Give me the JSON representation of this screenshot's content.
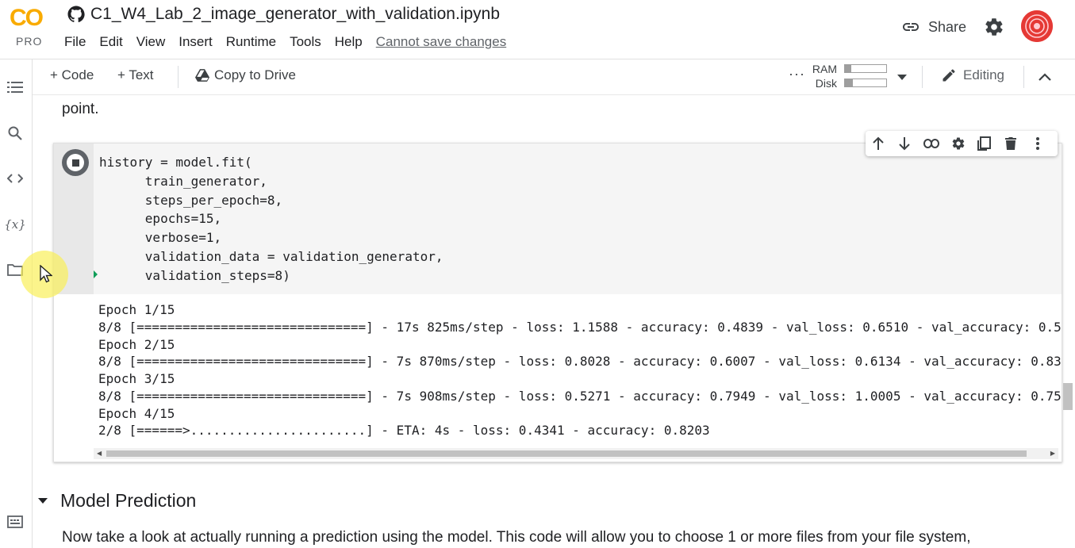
{
  "app": {
    "logo_text": "CO",
    "logo_tier": "PRO",
    "notebook_title": "C1_W4_Lab_2_image_generator_with_validation.ipynb",
    "menu": [
      "File",
      "Edit",
      "View",
      "Insert",
      "Runtime",
      "Tools",
      "Help"
    ],
    "cannot_save": "Cannot save changes",
    "share_label": "Share",
    "brand_color": "#f9ab00"
  },
  "toolbar": {
    "add_code": "+ Code",
    "add_text": "+ Text",
    "copy_to_drive": "Copy to Drive",
    "ram_label": "RAM",
    "disk_label": "Disk",
    "ram_usage": 0.15,
    "disk_usage": 0.2,
    "mode_label": "Editing"
  },
  "sidebar": {
    "items": [
      {
        "icon": "table-of-contents-icon"
      },
      {
        "icon": "search-icon"
      },
      {
        "icon": "code-snippets-icon"
      },
      {
        "icon": "variables-icon",
        "glyph": "{x}"
      },
      {
        "icon": "files-icon"
      },
      {
        "icon": "terminal-icon"
      }
    ]
  },
  "content": {
    "preceding_text": "point.",
    "code_lines": [
      "history = model.fit(",
      "      train_generator,",
      "      steps_per_epoch=8,",
      "      epochs=15,",
      "      verbose=1,",
      "      validation_data = validation_generator,",
      "      validation_steps=8)"
    ],
    "output_lines": [
      "Epoch 1/15",
      "8/8 [==============================] - 17s 825ms/step - loss: 1.1588 - accuracy: 0.4839 - val_loss: 0.6510 - val_accuracy: 0.5",
      "Epoch 2/15",
      "8/8 [==============================] - 7s 870ms/step - loss: 0.8028 - accuracy: 0.6007 - val_loss: 0.6134 - val_accuracy: 0.83",
      "Epoch 3/15",
      "8/8 [==============================] - 7s 908ms/step - loss: 0.5271 - accuracy: 0.7949 - val_loss: 1.0005 - val_accuracy: 0.75",
      "Epoch 4/15",
      "2/8 [======>.......................] - ETA: 4s - loss: 0.4341 - accuracy: 0.8203"
    ],
    "section_heading": "Model Prediction",
    "section_paragraph": "Now take a look at actually running a prediction using the model. This code will allow you to choose 1 or more files from your file system,"
  }
}
